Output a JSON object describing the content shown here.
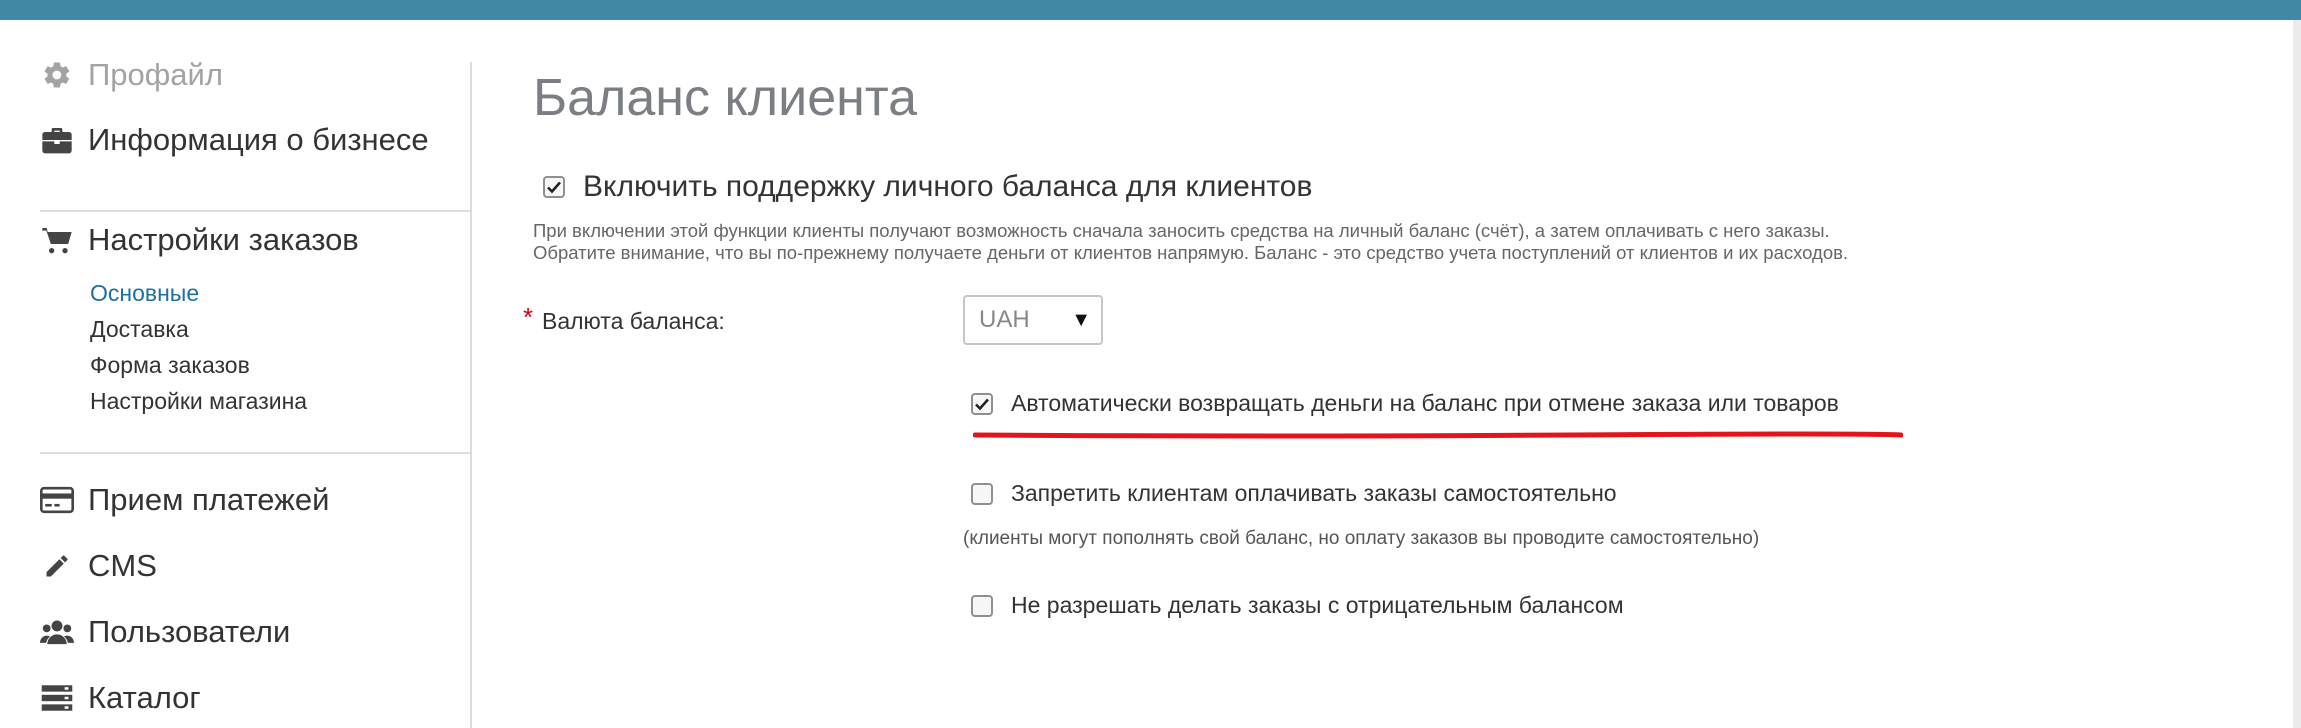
{
  "sidebar": {
    "profile": {
      "label": "Профайл",
      "icon": "gear-icon"
    },
    "business": {
      "label": "Информация о бизнесе",
      "icon": "briefcase-icon"
    },
    "orders": {
      "label": "Настройки заказов",
      "icon": "cart-icon",
      "sub": [
        {
          "label": "Основные",
          "active": true
        },
        {
          "label": "Доставка",
          "active": false
        },
        {
          "label": "Форма заказов",
          "active": false
        },
        {
          "label": "Настройки магазина",
          "active": false
        }
      ]
    },
    "payments": {
      "label": "Прием платежей",
      "icon": "credit-card-icon"
    },
    "cms": {
      "label": "CMS",
      "icon": "pencil-icon"
    },
    "users": {
      "label": "Пользователи",
      "icon": "users-icon"
    },
    "catalog": {
      "label": "Каталог",
      "icon": "catalog-icon"
    }
  },
  "main": {
    "title": "Баланс клиента",
    "enable_balance": {
      "label": "Включить поддержку личного баланса для клиентов",
      "checked": true
    },
    "help_line1": "При включении этой функции клиенты получают возможность сначала заносить средства на личный баланс (счёт), а затем оплачивать с него заказы.",
    "help_line2": "Обратите внимание, что вы по-прежнему получаете деньги от клиентов напрямую. Баланс - это средство учета поступлений от клиентов и их расходов.",
    "currency": {
      "required_mark": "*",
      "label": "Валюта баланса:",
      "value": "UAH"
    },
    "options": [
      {
        "label": "Автоматически возвращать деньги на баланс при отмене заказа или товаров",
        "checked": true
      },
      {
        "label": "Запретить клиентам оплачивать заказы самостоятельно",
        "checked": false
      },
      {
        "label": "Не разрешать делать заказы с отрицательным балансом",
        "checked": false
      }
    ],
    "option2_note": "(клиенты могут пополнять свой баланс, но оплату заказов вы проводите самостоятельно)"
  },
  "colors": {
    "topbar": "#418aa6",
    "active_link": "#1f6fa3",
    "annotation_underline": "#e3141b",
    "title": "#7b7f84"
  }
}
